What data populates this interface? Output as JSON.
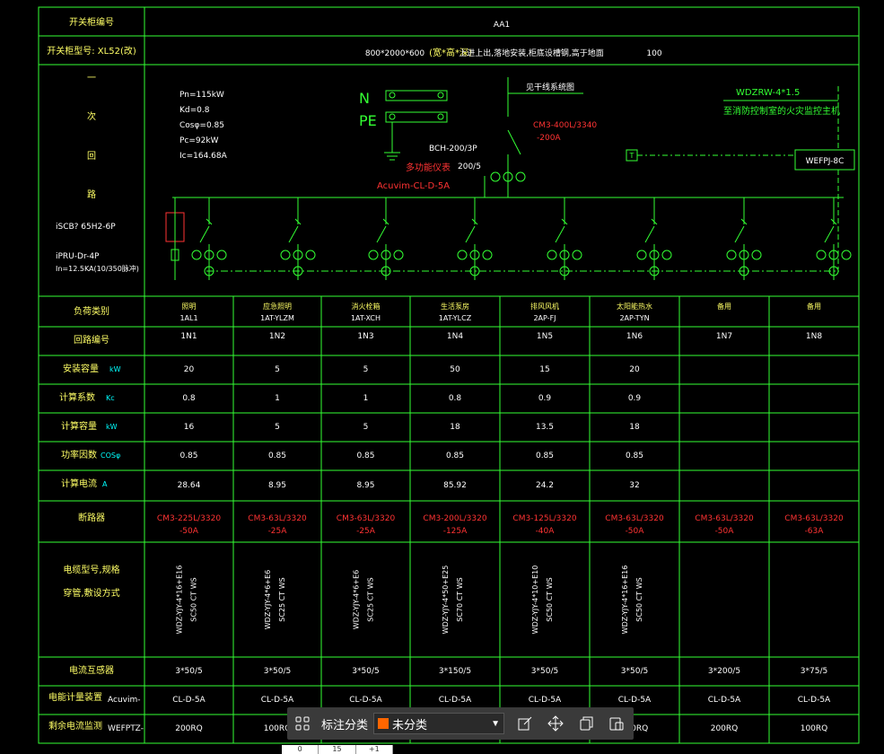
{
  "header": {
    "switch_no_label": "开关柜编号",
    "switch_no_value": "AA1",
    "model_label": "开关柜型号: XL52(改)",
    "dims": "800*2000*600",
    "dims_unit": "(宽*高*深)",
    "install_note": "上进上出,落地安装,柜底设槽钢,高于地面",
    "base_height": "100"
  },
  "primary": {
    "side_label": [
      "一",
      "次",
      "回",
      "路"
    ],
    "params": [
      "Pn=115kW",
      "Kd=0.8",
      "Cosφ=0.85",
      "Pc=92kW",
      "Ic=164.68A"
    ],
    "spd": "iSCB? 65H2-6P",
    "spd2": "iPRU-Dr-4P",
    "spd3": "In=12.5KA(10/350脉冲)",
    "n_label": "N",
    "pe_label": "PE",
    "bus_note": "见干线系统图",
    "main_breaker": "CM3-400L/3340",
    "main_breaker_a": "-200A",
    "ct_main": "BCH-200/3P",
    "ct_ratio": "200/5",
    "meter_label": "多功能仪表",
    "meter_model": "Acuvim-CL-D-5A",
    "fire_cable": "WDZRW-4*1.5",
    "fire_note": "至消防控制室的火灾监控主机",
    "t_box": "T",
    "wefp_box": "WEFPJ-8C"
  },
  "labels": {
    "load_type": "负荷类别",
    "circuit_no": "回路编号",
    "install_cap": "安装容量",
    "install_unit": "kW",
    "demand": "计算系数",
    "demand_unit": "Kc",
    "calc_cap": "计算容量",
    "calc_unit": "kW",
    "pf": "功率因数",
    "pf_unit": "COSφ",
    "current": "计算电流",
    "current_unit": "A",
    "breaker": "断路器",
    "cable_1": "电缆型号,规格",
    "cable_2": "穿管,敷设方式",
    "ct": "电流互感器",
    "meter": "电能计量装置",
    "meter_model": "Acuvim-",
    "leak": "剩余电流监测",
    "leak_model": "WEFPTZ-"
  },
  "columns": [
    {
      "name": "照明",
      "code": "1AL1",
      "no": "1N1",
      "kw": "20",
      "kc": "0.8",
      "pc": "16",
      "pf": "0.85",
      "ic": "28.64",
      "brk": "CM3-225L/3320",
      "brk_a": "-50A",
      "cable": "WDZ-YJY-4*16+E16",
      "pipe": "SC50 CT WS",
      "ct": "3*50/5",
      "meter": "CL-D-5A",
      "leak": "200RQ"
    },
    {
      "name": "应急照明",
      "code": "1AT-YLZM",
      "no": "1N2",
      "kw": "5",
      "kc": "1",
      "pc": "5",
      "pf": "0.85",
      "ic": "8.95",
      "brk": "CM3-63L/3320",
      "brk_a": "-25A",
      "cable": "WDZ-YJY-4*6+E6",
      "pipe": "SC25 CT WS",
      "ct": "3*50/5",
      "meter": "CL-D-5A",
      "leak": "100RQ"
    },
    {
      "name": "消火栓箱",
      "code": "1AT-XCH",
      "no": "1N3",
      "kw": "5",
      "kc": "1",
      "pc": "5",
      "pf": "0.85",
      "ic": "8.95",
      "brk": "CM3-63L/3320",
      "brk_a": "-25A",
      "cable": "WDZ-YJY-4*6+E6",
      "pipe": "SC25 CT WS",
      "ct": "3*50/5",
      "meter": "CL-D-5A",
      "leak": "200RQ"
    },
    {
      "name": "生活泵房",
      "code": "1AT-YLCZ",
      "no": "1N4",
      "kw": "50",
      "kc": "0.8",
      "pc": "18",
      "pf": "0.85",
      "ic": "85.92",
      "brk": "CM3-200L/3320",
      "brk_a": "-125A",
      "cable": "WDZ-YJY-4*50+E25",
      "pipe": "SC70 CT WS",
      "ct": "3*150/5",
      "meter": "CL-D-5A",
      "leak": "200RQ"
    },
    {
      "name": "排风风机",
      "code": "2AP-FJ",
      "no": "1N5",
      "kw": "15",
      "kc": "0.9",
      "pc": "13.5",
      "pf": "0.85",
      "ic": "24.2",
      "brk": "CM3-125L/3320",
      "brk_a": "-40A",
      "cable": "WDZ-YJY-4*10+E10",
      "pipe": "SC50 CT WS",
      "ct": "3*50/5",
      "meter": "CL-D-5A",
      "leak": "200RQ"
    },
    {
      "name": "太阳能热水",
      "code": "2AP-TYN",
      "no": "1N6",
      "kw": "20",
      "kc": "0.9",
      "pc": "18",
      "pf": "0.85",
      "ic": "32",
      "brk": "CM3-63L/3320",
      "brk_a": "-50A",
      "cable": "WDZ-YJY-4*16+E16",
      "pipe": "SC50 CT WS",
      "ct": "3*50/5",
      "meter": "CL-D-5A",
      "leak": "200RQ"
    },
    {
      "name": "备用",
      "code": "",
      "no": "1N7",
      "kw": "",
      "kc": "",
      "pc": "",
      "pf": "",
      "ic": "",
      "brk": "CM3-63L/3320",
      "brk_a": "-50A",
      "cable": "",
      "pipe": "",
      "ct": "3*200/5",
      "meter": "CL-D-5A",
      "leak": "200RQ"
    },
    {
      "name": "备用",
      "code": "",
      "no": "1N8",
      "kw": "",
      "kc": "",
      "pc": "",
      "pf": "",
      "ic": "",
      "brk": "CM3-63L/3320",
      "brk_a": "-63A",
      "cable": "",
      "pipe": "",
      "ct": "3*75/5",
      "meter": "CL-D-5A",
      "leak": "100RQ"
    }
  ],
  "toolbar": {
    "category_label": "标注分类",
    "category_value": "未分类",
    "swatch_color": "#ff6600"
  },
  "subbar": [
    "0",
    "15",
    "+1"
  ]
}
